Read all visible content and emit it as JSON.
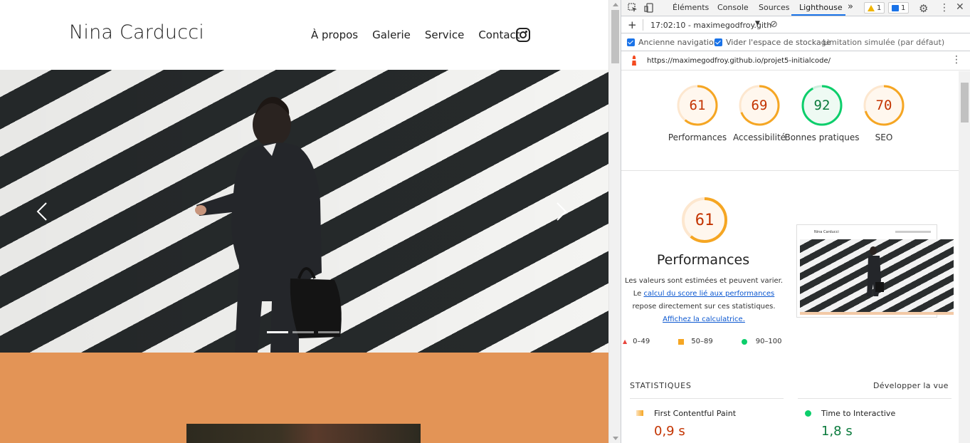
{
  "site": {
    "brand": "Nina Carducci",
    "nav": [
      "À propos",
      "Galerie",
      "Service",
      "Contact"
    ],
    "colors": {
      "about_bg": "#e39456"
    }
  },
  "devtools": {
    "tabs": [
      "Éléments",
      "Console",
      "Sources",
      "Lighthouse"
    ],
    "more_tabs_label": "»",
    "warnings": "1",
    "messages": "1",
    "report_selector": "17:02:10 - maximegodfroy.gith",
    "options": [
      "Ancienne navigation",
      "Vider l'espace de stockage"
    ],
    "throttling": "Limitation simulée (par défaut)",
    "url": "https://maximegodfroy.github.io/projet5-initialcode/",
    "scores": [
      {
        "value": 61,
        "label": "Performances",
        "color": "#f5a623"
      },
      {
        "value": 69,
        "label": "Accessibilité",
        "color": "#f5a623"
      },
      {
        "value": 92,
        "label": "Bonnes pratiques",
        "color": "#0cce6b"
      },
      {
        "value": 70,
        "label": "SEO",
        "color": "#f5a623"
      }
    ],
    "performance": {
      "score": 61,
      "title": "Performances",
      "desc_1": "Les valeurs sont estimées et peuvent varier. Le",
      "link_1": "calcul du score lié aux performances",
      "desc_2": "repose directement sur ces statistiques.",
      "link_2": "Affichez la calculatrice.",
      "legend": [
        "0–49",
        "50–89",
        "90–100"
      ],
      "thumb_brand": "Nina Carducci"
    },
    "stats": {
      "heading": "STATISTIQUES",
      "expand": "Développer la vue",
      "metrics": [
        {
          "name": "First Contentful Paint",
          "value": "0,9 s",
          "status": "average"
        },
        {
          "name": "Time to Interactive",
          "value": "1,8 s",
          "status": "pass"
        }
      ]
    }
  }
}
